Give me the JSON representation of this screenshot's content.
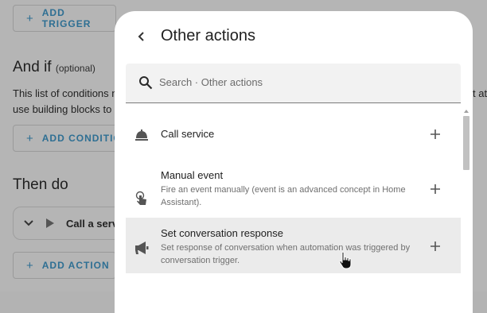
{
  "background": {
    "add_trigger_label": "ADD TRIGGER",
    "and_if_heading": "And if",
    "and_if_optional": "(optional)",
    "conditions_text_line1": "This list of conditions n",
    "conditions_text_line2": "use building blocks to c",
    "conditions_text_right": "t at",
    "add_condition_label": "ADD CONDITION",
    "then_do_heading": "Then do",
    "action_card_label": "Call a servi",
    "add_action_label": "ADD ACTION"
  },
  "dialog": {
    "title": "Other actions",
    "search": {
      "placeholder": "Search · Other actions",
      "value": ""
    },
    "items": [
      {
        "icon": "bell-icon",
        "title": "Call service",
        "description": ""
      },
      {
        "icon": "gesture-tap-icon",
        "title": "Manual event",
        "description": "Fire an event manually (event is an advanced concept in Home Assistant)."
      },
      {
        "icon": "bullhorn-icon",
        "title": "Set conversation response",
        "description": "Set response of conversation when automation was triggered by conversation trigger."
      }
    ]
  },
  "colors": {
    "accent": "#2e6f93",
    "scrim": "#b5b5b5",
    "hover_row": "#ebebeb"
  }
}
